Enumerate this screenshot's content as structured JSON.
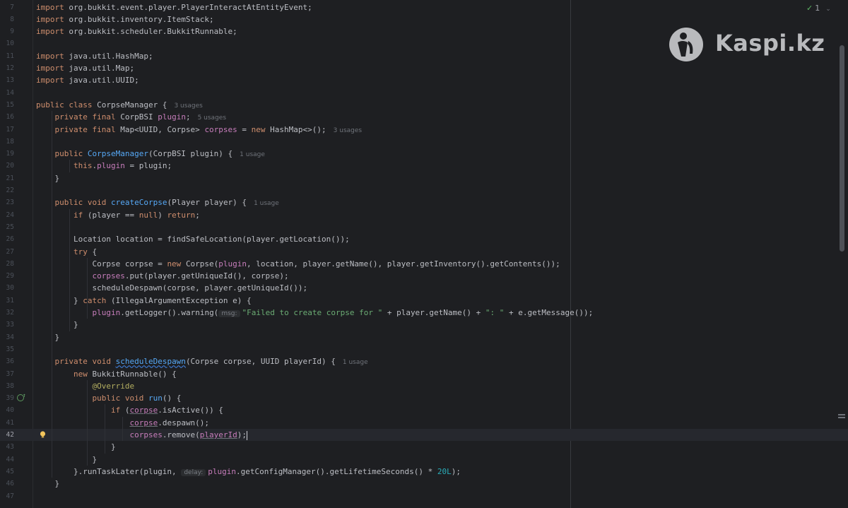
{
  "inspection": {
    "count": "1",
    "check_icon": "check-icon",
    "chevron_icon": "chevron-down-icon"
  },
  "watermark": {
    "text": "Kaspi.kz",
    "logo": "kaspi-logo"
  },
  "lines": [
    {
      "num": "7",
      "t": [
        [
          "kw",
          "import "
        ],
        [
          "plain",
          "org.bukkit.event.player.PlayerInteractAtEntityEvent;"
        ]
      ]
    },
    {
      "num": "8",
      "t": [
        [
          "kw",
          "import "
        ],
        [
          "plain",
          "org.bukkit.inventory.ItemStack;"
        ]
      ]
    },
    {
      "num": "9",
      "t": [
        [
          "kw",
          "import "
        ],
        [
          "plain",
          "org.bukkit.scheduler.BukkitRunnable;"
        ]
      ]
    },
    {
      "num": "10",
      "t": []
    },
    {
      "num": "11",
      "t": [
        [
          "kw",
          "import "
        ],
        [
          "plain",
          "java.util.HashMap;"
        ]
      ]
    },
    {
      "num": "12",
      "t": [
        [
          "kw",
          "import "
        ],
        [
          "plain",
          "java.util.Map;"
        ]
      ]
    },
    {
      "num": "13",
      "t": [
        [
          "kw",
          "import "
        ],
        [
          "plain",
          "java.util.UUID;"
        ]
      ]
    },
    {
      "num": "14",
      "t": []
    },
    {
      "num": "15",
      "t": [
        [
          "kw",
          "public class "
        ],
        [
          "plain",
          "CorpseManager {"
        ],
        [
          "hint",
          "3 usages"
        ]
      ]
    },
    {
      "num": "16",
      "t": [
        [
          "plain",
          "    "
        ],
        [
          "kw",
          "private final "
        ],
        [
          "plain",
          "CorpBSI "
        ],
        [
          "fld",
          "plugin"
        ],
        [
          "plain",
          ";"
        ],
        [
          "hint",
          "5 usages"
        ]
      ]
    },
    {
      "num": "17",
      "t": [
        [
          "plain",
          "    "
        ],
        [
          "kw",
          "private final "
        ],
        [
          "plain",
          "Map<UUID, Corpse> "
        ],
        [
          "fld",
          "corpses"
        ],
        [
          "plain",
          " = "
        ],
        [
          "kw",
          "new "
        ],
        [
          "plain",
          "HashMap<>();"
        ],
        [
          "hint",
          "3 usages"
        ]
      ]
    },
    {
      "num": "18",
      "t": []
    },
    {
      "num": "19",
      "t": [
        [
          "plain",
          "    "
        ],
        [
          "kw",
          "public "
        ],
        [
          "fn",
          "CorpseManager"
        ],
        [
          "plain",
          "(CorpBSI plugin) {"
        ],
        [
          "hint",
          "1 usage"
        ]
      ]
    },
    {
      "num": "20",
      "t": [
        [
          "plain",
          "        "
        ],
        [
          "kw",
          "this"
        ],
        [
          "plain",
          "."
        ],
        [
          "fld",
          "plugin"
        ],
        [
          "plain",
          " = plugin;"
        ]
      ]
    },
    {
      "num": "21",
      "t": [
        [
          "plain",
          "    }"
        ]
      ]
    },
    {
      "num": "22",
      "t": []
    },
    {
      "num": "23",
      "t": [
        [
          "plain",
          "    "
        ],
        [
          "kw",
          "public void "
        ],
        [
          "fn",
          "createCorpse"
        ],
        [
          "plain",
          "(Player player) {"
        ],
        [
          "hint",
          "1 usage"
        ]
      ]
    },
    {
      "num": "24",
      "t": [
        [
          "plain",
          "        "
        ],
        [
          "kw",
          "if "
        ],
        [
          "plain",
          "(player == "
        ],
        [
          "kw",
          "null"
        ],
        [
          "plain",
          ") "
        ],
        [
          "kw",
          "return"
        ],
        [
          "plain",
          ";"
        ]
      ]
    },
    {
      "num": "25",
      "t": []
    },
    {
      "num": "26",
      "t": [
        [
          "plain",
          "        Location location = findSafeLocation(player.getLocation());"
        ]
      ]
    },
    {
      "num": "27",
      "t": [
        [
          "plain",
          "        "
        ],
        [
          "kw",
          "try "
        ],
        [
          "plain",
          "{"
        ]
      ]
    },
    {
      "num": "28",
      "t": [
        [
          "plain",
          "            Corpse corpse = "
        ],
        [
          "kw",
          "new "
        ],
        [
          "plain",
          "Corpse("
        ],
        [
          "fld",
          "plugin"
        ],
        [
          "plain",
          ", location, player.getName(), player.getInventory().getContents());"
        ]
      ]
    },
    {
      "num": "29",
      "t": [
        [
          "plain",
          "            "
        ],
        [
          "fld",
          "corpses"
        ],
        [
          "plain",
          ".put(player.getUniqueId(), corpse);"
        ]
      ]
    },
    {
      "num": "30",
      "t": [
        [
          "plain",
          "            scheduleDespawn(corpse, player.getUniqueId());"
        ]
      ]
    },
    {
      "num": "31",
      "t": [
        [
          "plain",
          "        } "
        ],
        [
          "kw",
          "catch "
        ],
        [
          "plain",
          "(IllegalArgumentException e) {"
        ]
      ]
    },
    {
      "num": "32",
      "t": [
        [
          "plain",
          "            "
        ],
        [
          "fld",
          "plugin"
        ],
        [
          "plain",
          ".getLogger().warning("
        ],
        [
          "param",
          "msg:"
        ],
        [
          "str",
          "\"Failed to create corpse for \""
        ],
        [
          "plain",
          " + player.getName() + "
        ],
        [
          "str",
          "\": \""
        ],
        [
          "plain",
          " + e.getMessage());"
        ]
      ]
    },
    {
      "num": "33",
      "t": [
        [
          "plain",
          "        }"
        ]
      ]
    },
    {
      "num": "34",
      "t": [
        [
          "plain",
          "    }"
        ]
      ]
    },
    {
      "num": "35",
      "t": []
    },
    {
      "num": "36",
      "t": [
        [
          "plain",
          "    "
        ],
        [
          "kw",
          "private void "
        ],
        [
          "fnw",
          "scheduleDespawn"
        ],
        [
          "plain",
          "(Corpse corpse, UUID playerId) {"
        ],
        [
          "hint",
          "1 usage"
        ]
      ]
    },
    {
      "num": "37",
      "t": [
        [
          "plain",
          "        "
        ],
        [
          "kw",
          "new "
        ],
        [
          "plain",
          "BukkitRunnable() {"
        ]
      ]
    },
    {
      "num": "38",
      "t": [
        [
          "plain",
          "            "
        ],
        [
          "ann",
          "@Override"
        ]
      ]
    },
    {
      "num": "39",
      "t": [
        [
          "plain",
          "            "
        ],
        [
          "kw",
          "public void "
        ],
        [
          "fn",
          "run"
        ],
        [
          "plain",
          "() {"
        ]
      ]
    },
    {
      "num": "40",
      "t": [
        [
          "plain",
          "                "
        ],
        [
          "kw",
          "if "
        ],
        [
          "plain",
          "("
        ],
        [
          "fldu",
          "corpse"
        ],
        [
          "plain",
          ".isActive()) {"
        ]
      ]
    },
    {
      "num": "41",
      "t": [
        [
          "plain",
          "                    "
        ],
        [
          "fldu",
          "corpse"
        ],
        [
          "plain",
          ".despawn();"
        ]
      ]
    },
    {
      "num": "42",
      "t": [
        [
          "plain",
          "                    "
        ],
        [
          "fld",
          "corpses"
        ],
        [
          "plain",
          ".remove("
        ],
        [
          "fldu",
          "playerId"
        ],
        [
          "plain",
          ");"
        ],
        [
          "caret",
          ""
        ]
      ]
    },
    {
      "num": "43",
      "t": [
        [
          "plain",
          "                }"
        ]
      ]
    },
    {
      "num": "44",
      "t": [
        [
          "plain",
          "            }"
        ]
      ]
    },
    {
      "num": "45",
      "t": [
        [
          "plain",
          "        }.runTaskLater(plugin, "
        ],
        [
          "param",
          "delay:"
        ],
        [
          "fld",
          "plugin"
        ],
        [
          "plain",
          ".getConfigManager().getLifetimeSeconds() * "
        ],
        [
          "num",
          "20L"
        ],
        [
          "plain",
          ");"
        ]
      ]
    },
    {
      "num": "46",
      "t": [
        [
          "plain",
          "    }"
        ]
      ]
    },
    {
      "num": "47",
      "t": []
    }
  ]
}
